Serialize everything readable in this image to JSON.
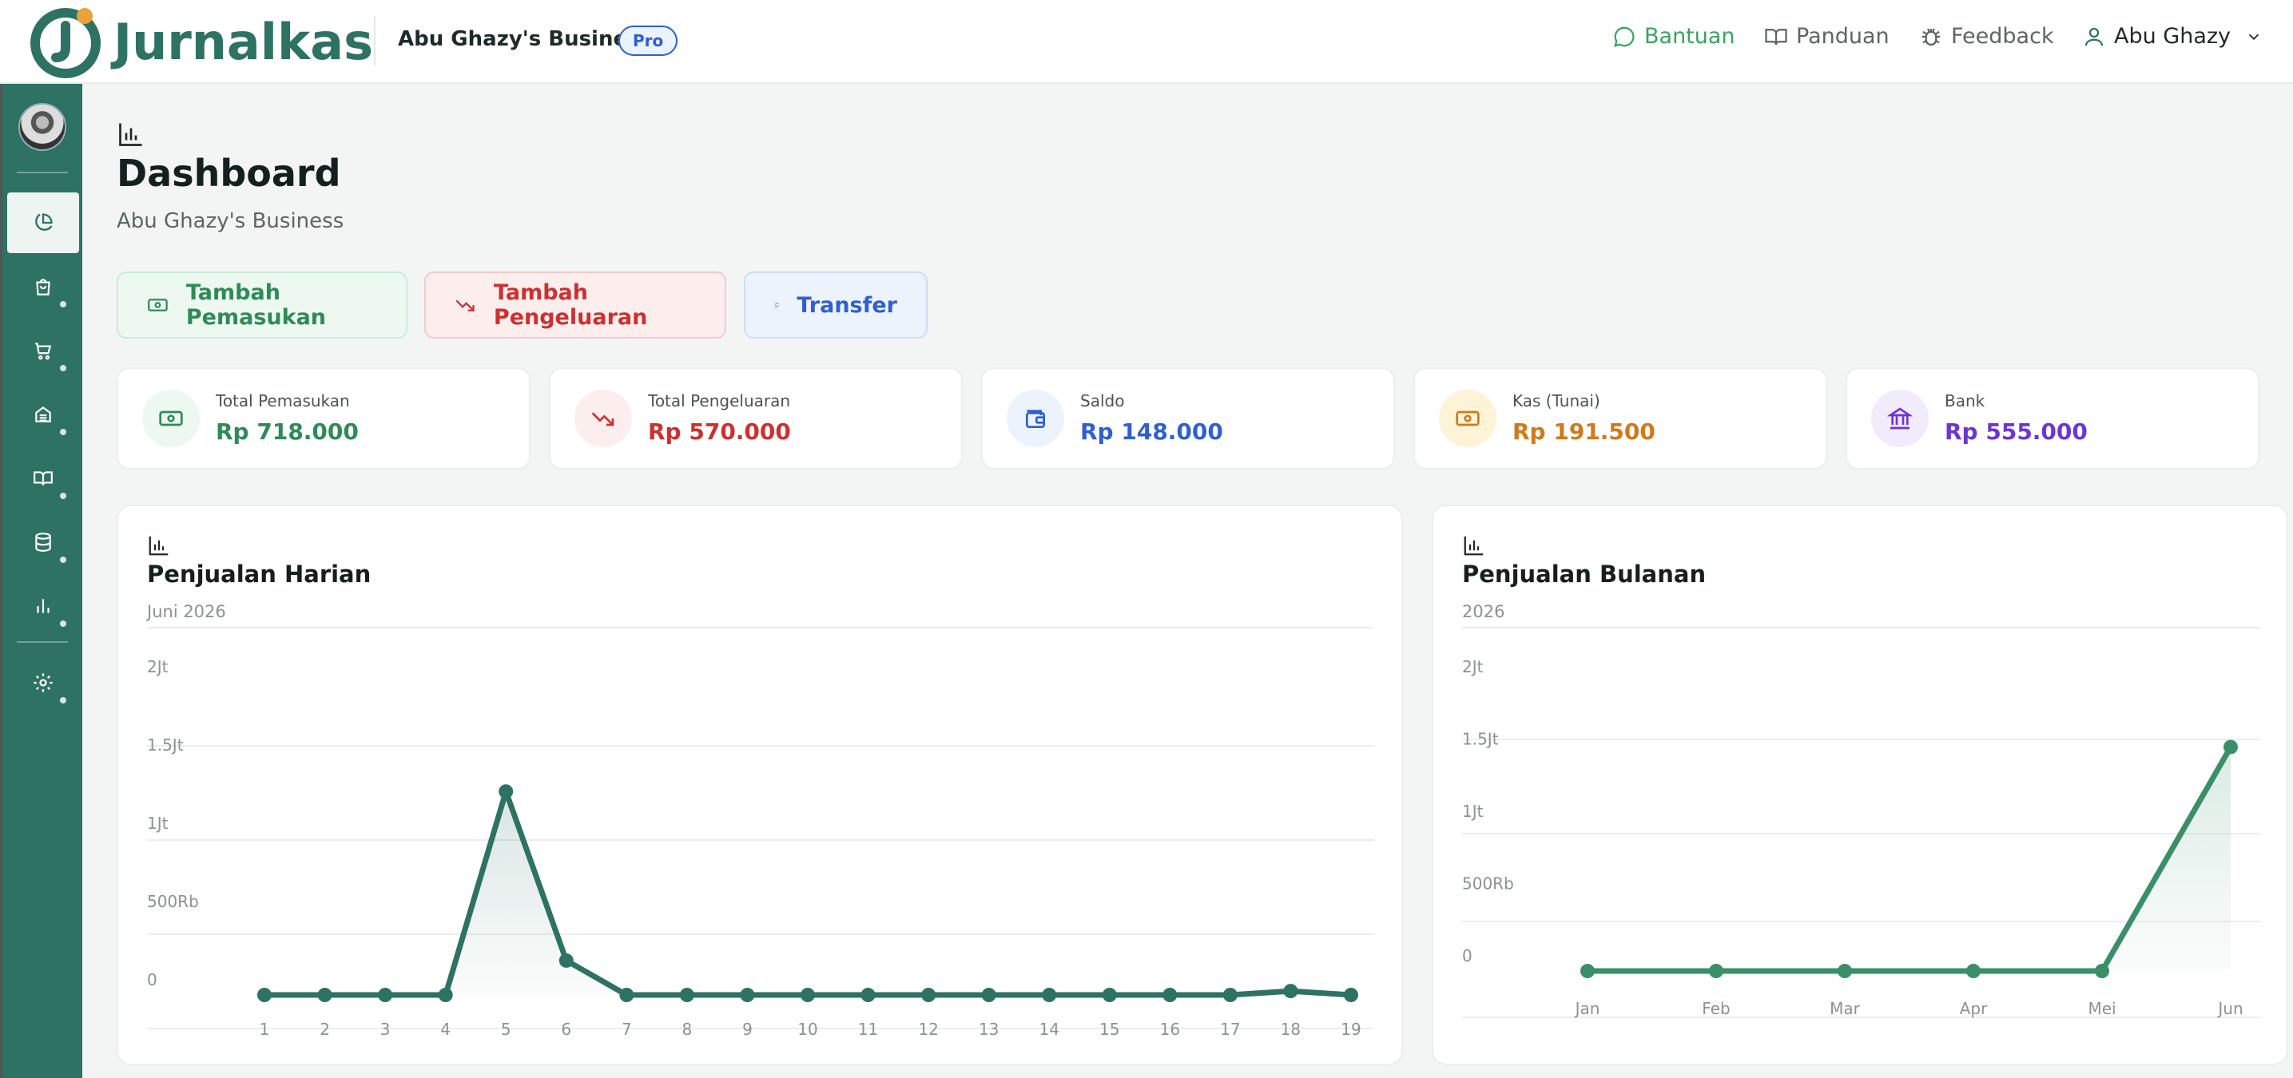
{
  "app": {
    "name": "Jurnalkas",
    "business": "Abu Ghazy's Business",
    "plan_badge": "Pro"
  },
  "top_nav": {
    "help": "Bantuan",
    "guide": "Panduan",
    "feedback": "Feedback",
    "user": "Abu Ghazy"
  },
  "colors": {
    "brand": "#2d7263",
    "income": "#2e8b57",
    "expense": "#cf2f2f",
    "balance": "#2f5fd0",
    "cash": "#d07a1c",
    "bank": "#6d35d6"
  },
  "sidebar": {
    "items": [
      {
        "icon": "pie-chart-icon",
        "active": true
      },
      {
        "icon": "shopping-bag-icon",
        "active": false
      },
      {
        "icon": "cart-icon",
        "active": false
      },
      {
        "icon": "archive-icon",
        "active": false
      },
      {
        "icon": "book-icon",
        "active": false
      },
      {
        "icon": "database-icon",
        "active": false
      },
      {
        "icon": "bar-chart-icon",
        "active": false
      },
      {
        "icon": "settings-icon",
        "active": false
      }
    ]
  },
  "page": {
    "title": "Dashboard",
    "subtitle": "Abu Ghazy's Business"
  },
  "actions": {
    "income": "Tambah Pemasukan",
    "expense": "Tambah Pengeluaran",
    "transfer": "Transfer"
  },
  "stats": [
    {
      "label": "Total Pemasukan",
      "value": "Rp 718.000",
      "icon": "money-icon"
    },
    {
      "label": "Total Pengeluaran",
      "value": "Rp 570.000",
      "icon": "trending-down-icon"
    },
    {
      "label": "Saldo",
      "value": "Rp 148.000",
      "icon": "wallet-icon"
    },
    {
      "label": "Kas (Tunai)",
      "value": "Rp 191.500",
      "icon": "cash-icon"
    },
    {
      "label": "Bank",
      "value": "Rp 555.000",
      "icon": "bank-icon"
    }
  ],
  "chart_data": [
    {
      "type": "line",
      "title": "Penjualan Harian",
      "subtitle": "Juni 2026",
      "x": [
        "1",
        "2",
        "3",
        "4",
        "5",
        "6",
        "7",
        "8",
        "9",
        "10",
        "11",
        "12",
        "13",
        "14",
        "15",
        "16",
        "17",
        "18",
        "19"
      ],
      "values": [
        0,
        0,
        0,
        0,
        1300000,
        220000,
        0,
        0,
        0,
        0,
        0,
        0,
        0,
        0,
        0,
        0,
        0,
        25000,
        0
      ],
      "y_ticks": [
        "0",
        "500Rb",
        "1Jt",
        "1.5Jt",
        "2Jt"
      ],
      "ylim": [
        0,
        2000000
      ],
      "grid": true,
      "area_fill": true
    },
    {
      "type": "line",
      "title": "Penjualan Bulanan",
      "subtitle": "2026",
      "x": [
        "Jan",
        "Feb",
        "Mar",
        "Apr",
        "Mei",
        "Jun"
      ],
      "values": [
        0,
        0,
        0,
        0,
        0,
        1550000
      ],
      "y_ticks": [
        "0",
        "500Rb",
        "1Jt",
        "1.5Jt",
        "2Jt"
      ],
      "ylim": [
        0,
        2000000
      ],
      "grid": true,
      "area_fill": true
    }
  ]
}
